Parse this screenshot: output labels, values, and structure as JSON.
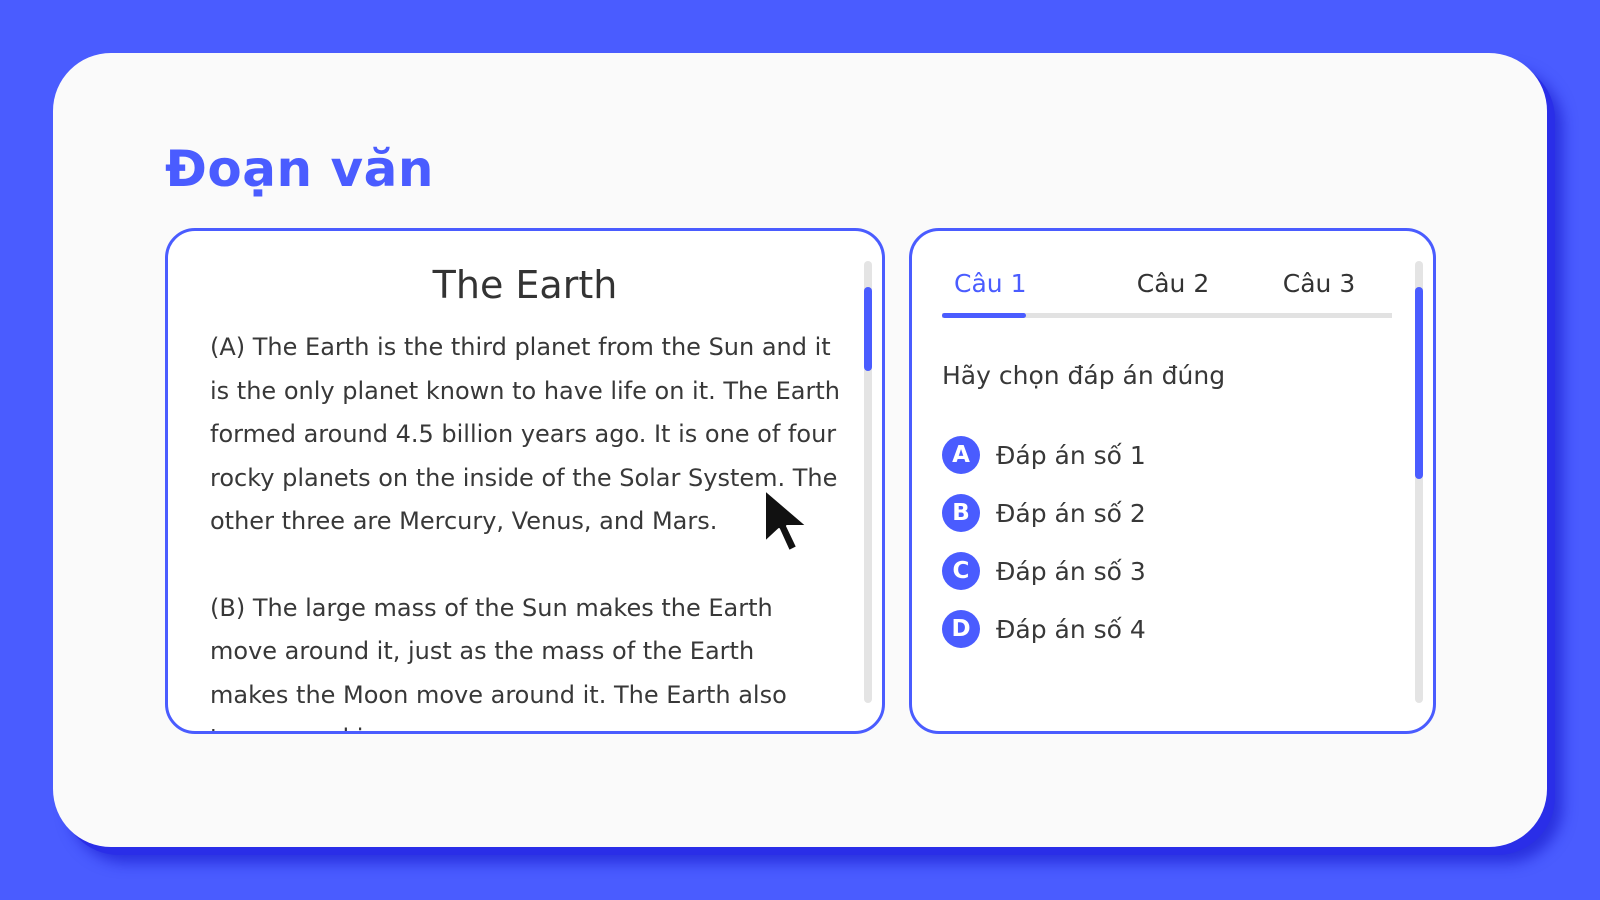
{
  "page": {
    "title": "Đoạn văn"
  },
  "passage": {
    "title": "The Earth",
    "paragraphs": [
      "(A) The Earth is the third planet from the Sun and it is the only planet known to have life on it. The Earth formed around 4.5 billion years ago. It is one of four rocky planets on the inside of the Solar System. The other three are Mercury, Venus, and Mars.",
      "(B) The large mass of the Sun makes the Earth move around it, just as the mass of the Earth makes the Moon move around it. The Earth also turns round in"
    ]
  },
  "quiz": {
    "tabs": [
      {
        "label": "Câu 1",
        "active": true
      },
      {
        "label": "Câu 2",
        "active": false
      },
      {
        "label": "Câu 3",
        "active": false
      }
    ],
    "instruction": "Hãy chọn đáp án đúng",
    "options": [
      {
        "letter": "A",
        "text": "Đáp án số 1"
      },
      {
        "letter": "B",
        "text": "Đáp án số 2"
      },
      {
        "letter": "C",
        "text": "Đáp án số 3"
      },
      {
        "letter": "D",
        "text": "Đáp án số 4"
      }
    ]
  },
  "colors": {
    "accent": "#4a5cff",
    "background": "#fafafa",
    "text": "#383838"
  },
  "icons": {
    "cursor": "mouse-pointer-icon"
  }
}
